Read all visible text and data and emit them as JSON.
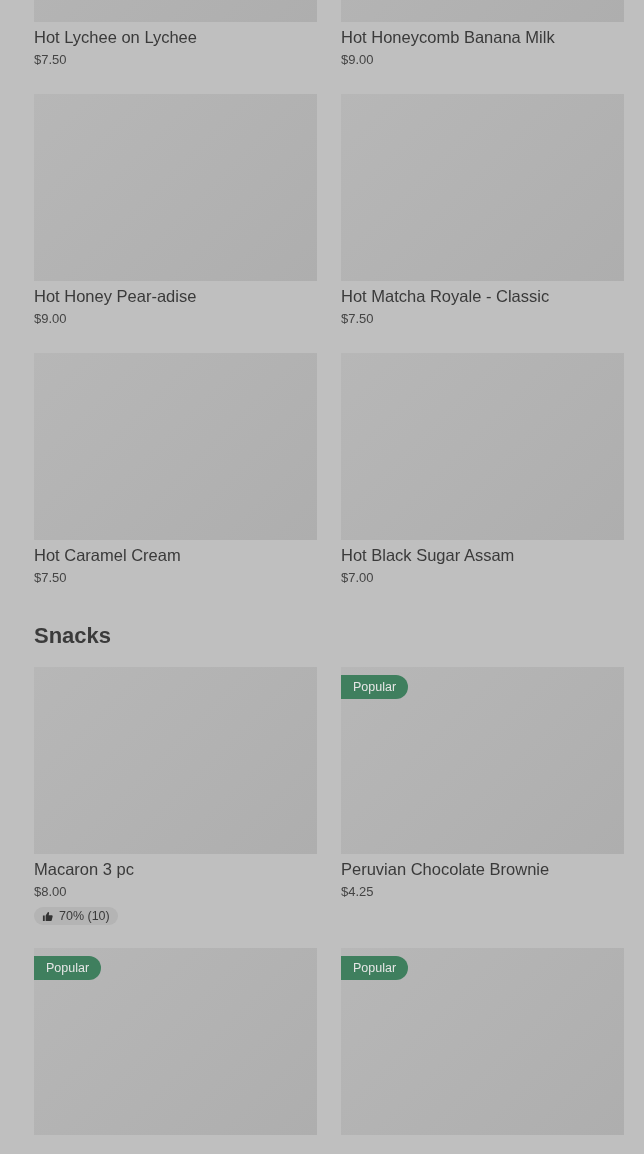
{
  "sections": [
    {
      "items": [
        {
          "name": "Hot Lychee on Lychee",
          "price": "$7.50"
        },
        {
          "name": "Hot Honeycomb Banana Milk",
          "price": "$9.00"
        },
        {
          "name": "Hot Honey Pear-adise",
          "price": "$9.00"
        },
        {
          "name": "Hot Matcha Royale - Classic",
          "price": "$7.50"
        },
        {
          "name": "Hot Caramel Cream",
          "price": "$7.50"
        },
        {
          "name": "Hot Black Sugar Assam",
          "price": "$7.00"
        }
      ]
    },
    {
      "heading": "Snacks",
      "items": [
        {
          "name": "Macaron 3 pc",
          "price": "$8.00",
          "rating": "70% (10)"
        },
        {
          "name": "Peruvian Chocolate Brownie",
          "price": "$4.25",
          "badge": "Popular"
        },
        {
          "badge": "Popular"
        },
        {
          "badge": "Popular"
        }
      ]
    }
  ]
}
